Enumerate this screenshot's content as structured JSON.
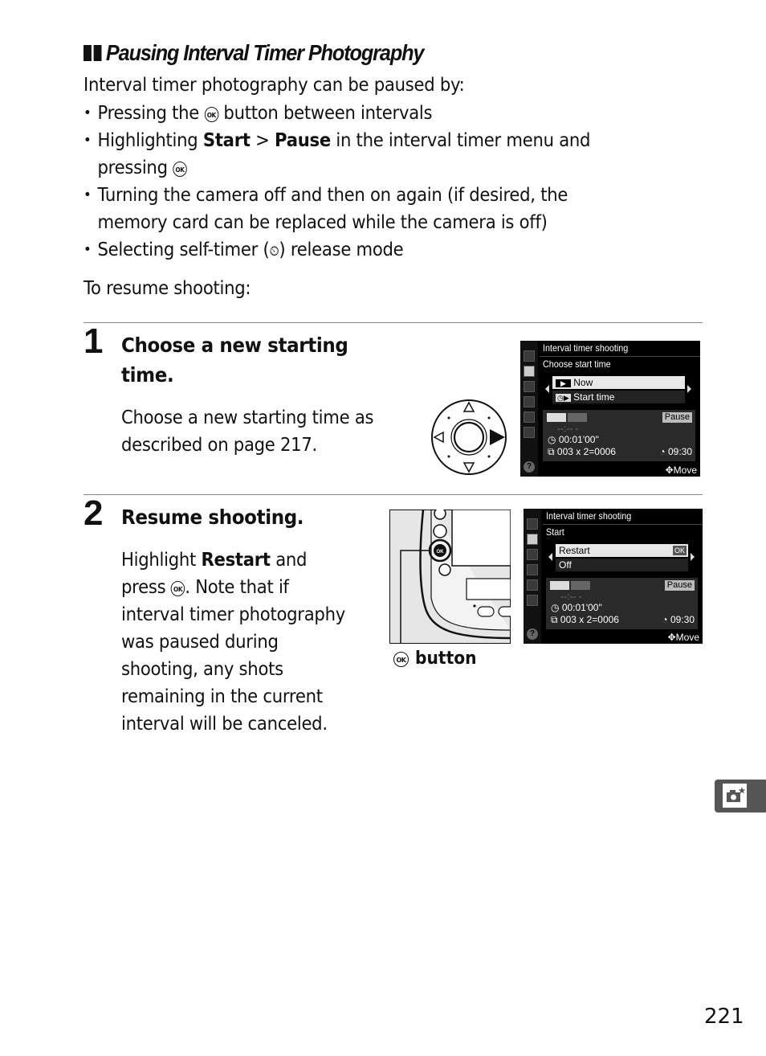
{
  "section": {
    "title": "Pausing Interval Timer Photography",
    "intro": "Interval timer photography can be paused by:",
    "bullets": [
      {
        "pre": "Pressing the ",
        "icon": "OK",
        "post": " button between intervals"
      },
      {
        "pre": "Highlighting ",
        "bold1": "Start",
        "mid": " > ",
        "bold2": "Pause",
        "post": " in the interval timer menu and",
        "line2_pre": "pressing ",
        "line2_icon": "OK"
      },
      {
        "line1": "Turning the camera off and then on again (if desired, the",
        "line2": "memory card can be replaced while the camera is off)"
      },
      {
        "pre": "Selecting self-timer (",
        "icon": "⏲",
        "post": ") release mode"
      }
    ],
    "resume_label": "To resume shooting:"
  },
  "steps": [
    {
      "number": "1",
      "title_line1": "Choose a new starting",
      "title_line2": "time.",
      "body_line1": "Choose a new starting time as",
      "body_line2": "described on page 217.",
      "screen": {
        "header": "Interval timer shooting",
        "subheader": "Choose start time",
        "options": [
          {
            "icon": "▶",
            "label": "Now",
            "selected": true
          },
          {
            "icon": "◷▶",
            "label": "Start time",
            "selected": false
          }
        ],
        "status": "Pause",
        "start_time": "--:-- -",
        "interval": "00:01'00\"",
        "shots": "003 x 2=0006",
        "clock": "09:30",
        "nav_hint": "Move"
      }
    },
    {
      "number": "2",
      "title": "Resume shooting.",
      "body": {
        "pre": "Highlight ",
        "bold": "Restart",
        "mid": " and",
        "line2_pre": "press ",
        "line2_icon": "OK",
        "line2_post": ".  Note that if",
        "lines": [
          "interval timer photography",
          "was paused during",
          "shooting, any shots",
          "remaining in the current",
          "interval will be canceled."
        ]
      },
      "camera_caption": "button",
      "camera_caption_icon": "OK",
      "screen": {
        "header": "Interval timer shooting",
        "subheader": "Start",
        "options": [
          {
            "label": "Restart",
            "badge": "OK",
            "selected": true
          },
          {
            "label": "Off",
            "selected": false
          }
        ],
        "status": "Pause",
        "start_time": "--:-- -",
        "interval": "00:01'00\"",
        "shots": "003 x 2=0006",
        "clock": "09:30",
        "nav_hint": "Move"
      }
    }
  ],
  "page_number": "221",
  "side_tab_icon": "camera-star-icon"
}
